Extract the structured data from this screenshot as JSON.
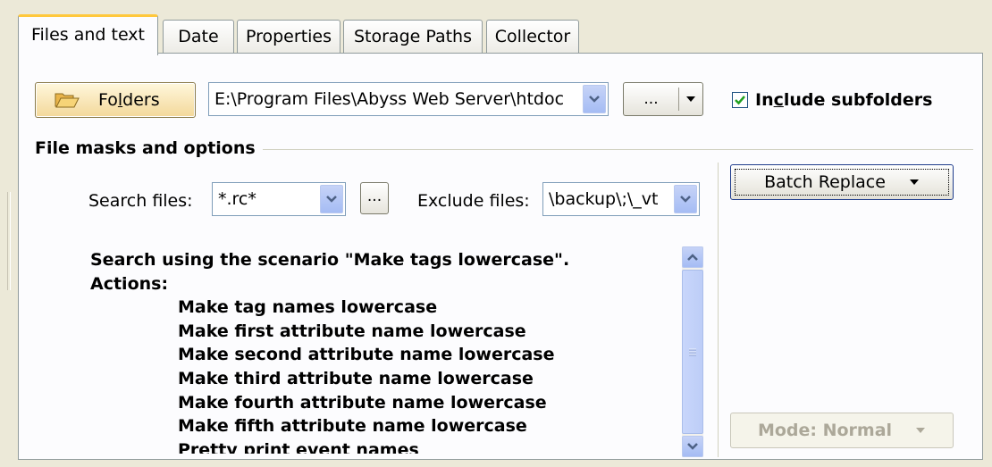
{
  "tabs": [
    {
      "label": "Files and text",
      "active": true
    },
    {
      "label": "Date",
      "active": false
    },
    {
      "label": "Properties",
      "active": false
    },
    {
      "label": "Storage Paths",
      "active": false
    },
    {
      "label": "Collector",
      "active": false
    }
  ],
  "folders": {
    "button_label_pre": "Fo",
    "button_label_accel": "l",
    "button_label_post": "ders",
    "path_value": "E:\\Program Files\\Abyss Web Server\\htdoc",
    "ellipsis_label": "...",
    "include_subfolders_pre": "In",
    "include_subfolders_accel": "c",
    "include_subfolders_post": "lude subfolders",
    "include_subfolders_checked": true
  },
  "file_masks": {
    "section_title": "File masks and options",
    "search_files_label": "Search files:",
    "search_files_value": "*.rc*",
    "ellipsis_label": "...",
    "exclude_files_label": "Exclude files:",
    "exclude_files_value": "\\backup\\;\\_vt"
  },
  "scenario": {
    "intro": "Search using the scenario \"Make tags lowercase\".",
    "actions_label": "Actions:",
    "actions": [
      "Make tag names lowercase",
      "Make first attribute name lowercase",
      "Make second attribute name lowercase",
      "Make third attribute name lowercase",
      "Make fourth attribute name lowercase",
      "Make fifth attribute name lowercase",
      "Pretty print event names"
    ]
  },
  "batch_replace_label": "Batch Replace",
  "mode_label": "Mode: Normal",
  "colors": {
    "background": "#ece9d8",
    "panel": "#fcfcfe",
    "active_tab_accent": "#ffc83c",
    "xp_blue_button": "#a5bcf4",
    "disabled_text": "#aca899"
  },
  "icons": {
    "folders": "open-folder-icon",
    "combo": "chevron-down-icon",
    "scroll_up": "chevron-up-icon",
    "scroll_down": "chevron-down-icon",
    "checkbox": "checkmark-icon"
  }
}
